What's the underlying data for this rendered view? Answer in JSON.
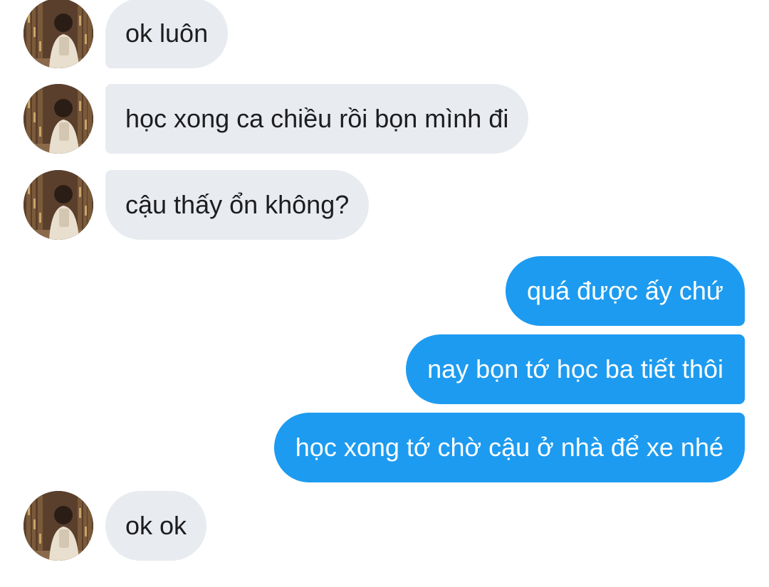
{
  "messages": [
    {
      "from": "them",
      "text": "ok luôn"
    },
    {
      "from": "them",
      "text": "học xong ca chiều rồi bọn mình đi"
    },
    {
      "from": "them",
      "text": "cậu thấy ổn không?"
    },
    {
      "from": "me",
      "text": "quá được ấy chứ"
    },
    {
      "from": "me",
      "text": "nay bọn tớ học ba tiết thôi"
    },
    {
      "from": "me",
      "text": "học xong tớ chờ cậu ở nhà để xe nhé"
    },
    {
      "from": "them",
      "text": "ok ok"
    }
  ],
  "colors": {
    "incoming_bubble": "#e8ebef",
    "outgoing_bubble": "#1d9bf0",
    "incoming_text": "#1d1d1f",
    "outgoing_text": "#ffffff"
  },
  "avatar_icon": "avatar-photo"
}
